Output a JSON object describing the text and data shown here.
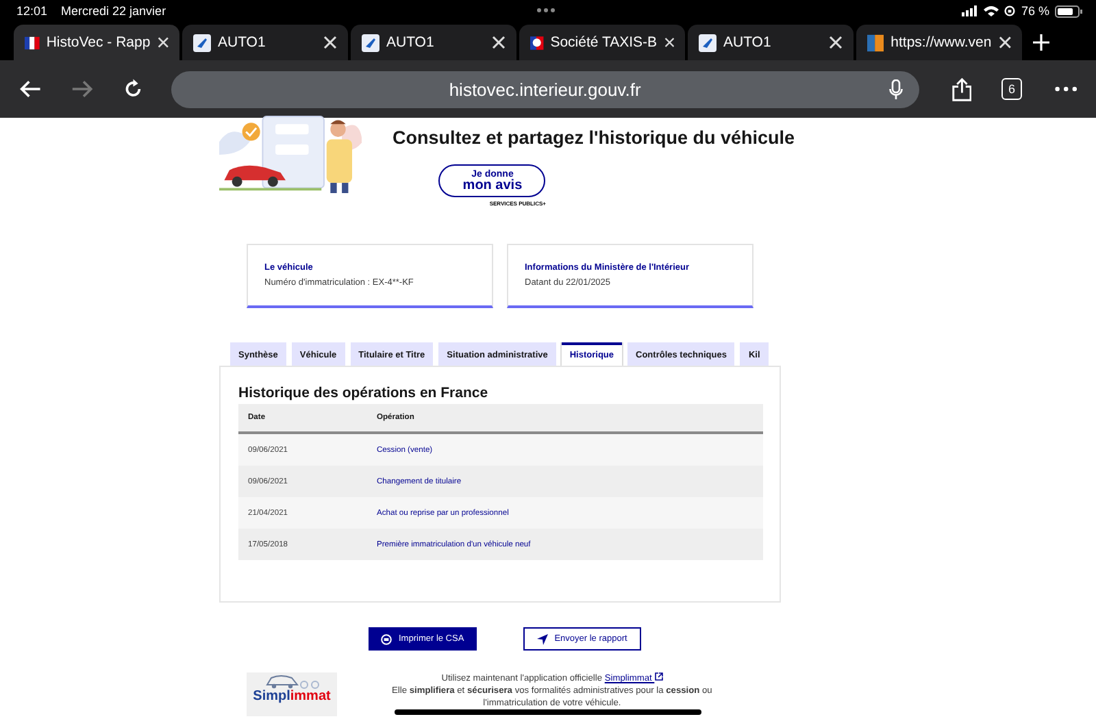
{
  "status_bar": {
    "time": "12:01",
    "date": "Mercredi 22 janvier",
    "battery": "76 %"
  },
  "browser_tabs": [
    {
      "title": "HistoVec - Rapp",
      "kind": "flag",
      "selected": true
    },
    {
      "title": "AUTO1",
      "kind": "auto1",
      "selected": false
    },
    {
      "title": "AUTO1",
      "kind": "auto1",
      "selected": false
    },
    {
      "title": "Société TAXIS-B",
      "kind": "marianne",
      "selected": false
    },
    {
      "title": "AUTO1",
      "kind": "auto1",
      "selected": false
    },
    {
      "title": "https://www.ven",
      "kind": "square",
      "selected": false
    }
  ],
  "toolbar": {
    "url": "histovec.interieur.gouv.fr",
    "tab_count": "6"
  },
  "hero": {
    "title": "Consultez et partagez l'historique du véhicule",
    "feedback_line_1": "Je donne",
    "feedback_line_2": "mon avis",
    "feedback_brand": "SERVICES PUBLICS+"
  },
  "cards": [
    {
      "title": "Le véhicule",
      "text": "Numéro d'immatriculation : EX-4**-KF"
    },
    {
      "title": "Informations du Ministère de l'Intérieur",
      "text": "Datant du 22/01/2025"
    }
  ],
  "tabs": [
    {
      "label": "Synthèse",
      "selected": false
    },
    {
      "label": "Véhicule",
      "selected": false
    },
    {
      "label": "Titulaire et Titre",
      "selected": false
    },
    {
      "label": "Situation administrative",
      "selected": false
    },
    {
      "label": "Historique",
      "selected": true
    },
    {
      "label": "Contrôles techniques",
      "selected": false
    },
    {
      "label": "Kil",
      "selected": false
    }
  ],
  "section_title": "Historique des opérations en France",
  "table": {
    "columns": [
      "Date",
      "Opération"
    ],
    "rows": [
      [
        "09/06/2021",
        "Cession (vente)"
      ],
      [
        "09/06/2021",
        "Changement de titulaire"
      ],
      [
        "21/04/2021",
        "Achat ou reprise par un professionnel"
      ],
      [
        "17/05/2018",
        "Première immatriculation d'un véhicule neuf"
      ]
    ]
  },
  "buttons": [
    {
      "label": "Imprimer le CSA",
      "kind": "primary"
    },
    {
      "label": "Envoyer le rapport",
      "kind": "secondary"
    }
  ],
  "promo": {
    "logo_part_1": "Simpl",
    "logo_part_2": "immat",
    "line_1": "Utilisez maintenant l'application officielle",
    "link": "Simplimmat",
    "line_2": "Elle **simplifiera** et **sécurisera** vos formalités administratives pour la **cession** ou",
    "line_3": "l'immatriculation de votre véhicule."
  }
}
